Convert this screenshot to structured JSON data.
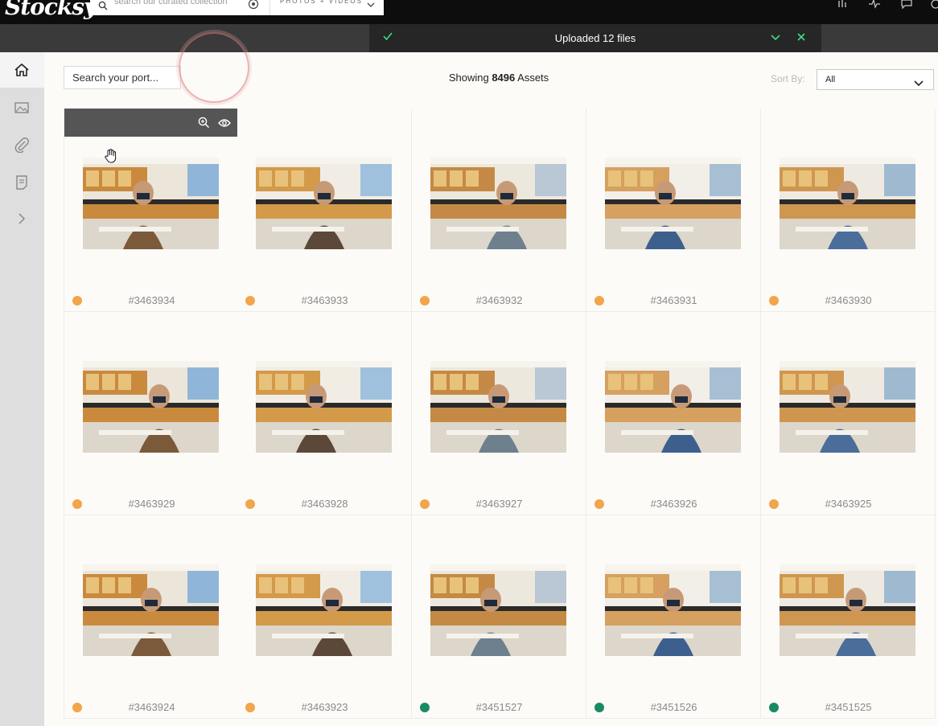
{
  "topbar": {
    "logo": "Stocksy",
    "search_placeholder": "search our curated collection",
    "media_type": "PHOTOS + VIDEOS"
  },
  "notification": {
    "message": "Uploaded 12 files"
  },
  "toolbar": {
    "portfolio_search_placeholder": "Search your port...",
    "showing_prefix": "Showing",
    "asset_count": "8496",
    "showing_suffix": "Assets",
    "sort_label": "Sort By:",
    "sort_value": "All"
  },
  "colors": {
    "dot_orange": "#f2a54a",
    "dot_green": "#1a8a63",
    "accent_green": "#3ddc84"
  },
  "assets": [
    {
      "id": "#3463934",
      "status": "orange"
    },
    {
      "id": "#3463933",
      "status": "orange"
    },
    {
      "id": "#3463932",
      "status": "orange"
    },
    {
      "id": "#3463931",
      "status": "orange"
    },
    {
      "id": "#3463930",
      "status": "orange"
    },
    {
      "id": "#3463929",
      "status": "orange"
    },
    {
      "id": "#3463928",
      "status": "orange"
    },
    {
      "id": "#3463927",
      "status": "orange"
    },
    {
      "id": "#3463926",
      "status": "orange"
    },
    {
      "id": "#3463925",
      "status": "orange"
    },
    {
      "id": "#3463924",
      "status": "orange"
    },
    {
      "id": "#3463923",
      "status": "orange"
    },
    {
      "id": "#3451527",
      "status": "green"
    },
    {
      "id": "#3451526",
      "status": "green"
    },
    {
      "id": "#3451525",
      "status": "green"
    }
  ]
}
